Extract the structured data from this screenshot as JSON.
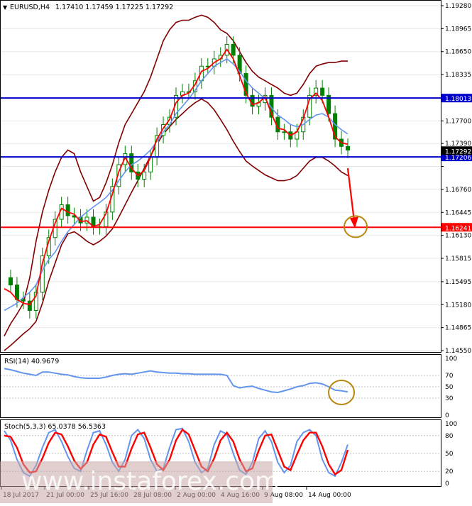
{
  "header": {
    "symbol_label": "EURUSD,H4",
    "ohlc": "1.17410 1.17459 1.17225 1.17292"
  },
  "rsi_panel": {
    "label": "RSI(14) 40.9679",
    "scale_labels": [
      "100",
      "70",
      "50",
      "30",
      "0"
    ]
  },
  "stoch_panel": {
    "label": "Stoch(5,3,3) 65.0378 56.5363",
    "scale_labels": [
      "100",
      "80",
      "50",
      "20",
      "0"
    ]
  },
  "watermark": "www.instaforex.com",
  "colors": {
    "candle": "#008000",
    "ma_fast": "#ff0000",
    "ma_slow": "#6495ed",
    "bollinger": "#800000",
    "level_line": "#0000cd",
    "target_line": "#ff0000",
    "rsi_line": "#6495ed",
    "stoch_main": "#6495ed",
    "stoch_signal": "#ff0000",
    "annotation": "#b8860b"
  },
  "chart_data": [
    {
      "type": "candlestick",
      "title": "EURUSD,H4",
      "x_ticks": [
        "18 Jul 2017",
        "21 Jul 00:00",
        "25 Jul 16:00",
        "28 Jul 08:00",
        "2 Aug 00:00",
        "4 Aug 16:00",
        "9 Aug 08:00",
        "14 Aug 00:00"
      ],
      "y_ticks": [
        1.1928,
        1.18965,
        1.1865,
        1.18335,
        1.1802,
        1.177,
        1.1739,
        1.17075,
        1.1676,
        1.16445,
        1.1613,
        1.15815,
        1.15495,
        1.1518,
        1.14865,
        1.1455
      ],
      "ylim": [
        1.1455,
        1.1928
      ],
      "price_labels": [
        "1.19280",
        "1.18965",
        "1.18650",
        "1.18335",
        "1.17700",
        "1.17390",
        "1.16760",
        "1.16445",
        "1.16130",
        "1.15815",
        "1.15495",
        "1.15180",
        "1.14865",
        "1.14550"
      ],
      "current_price": "1.17292",
      "horizontal_levels": [
        {
          "value": 1.18013,
          "label": "1.18013",
          "role": "resistance"
        },
        {
          "value": 1.17206,
          "label": "1.17206",
          "role": "support"
        },
        {
          "value": 1.16241,
          "label": "1.16241",
          "role": "target"
        }
      ],
      "close_path": [
        1.1555,
        1.1545,
        1.1525,
        1.1523,
        1.151,
        1.1535,
        1.1585,
        1.161,
        1.1635,
        1.1655,
        1.164,
        1.1638,
        1.163,
        1.1638,
        1.1625,
        1.1625,
        1.1645,
        1.168,
        1.171,
        1.1725,
        1.17,
        1.169,
        1.17,
        1.172,
        1.175,
        1.1765,
        1.1775,
        1.1805,
        1.181,
        1.181,
        1.1825,
        1.1845,
        1.1845,
        1.1855,
        1.186,
        1.1875,
        1.186,
        1.1835,
        1.1805,
        1.179,
        1.1795,
        1.1805,
        1.1775,
        1.1755,
        1.1755,
        1.1745,
        1.1755,
        1.1775,
        1.1805,
        1.1815,
        1.1805,
        1.178,
        1.1745,
        1.1735,
        1.173
      ],
      "ma_fast": [
        1.154,
        1.1535,
        1.1525,
        1.152,
        1.1518,
        1.153,
        1.1575,
        1.1605,
        1.163,
        1.165,
        1.1645,
        1.1642,
        1.1632,
        1.1633,
        1.1625,
        1.1628,
        1.1643,
        1.167,
        1.17,
        1.172,
        1.1705,
        1.1695,
        1.1702,
        1.172,
        1.1745,
        1.176,
        1.1772,
        1.1795,
        1.1805,
        1.1808,
        1.182,
        1.1838,
        1.1842,
        1.185,
        1.1855,
        1.1868,
        1.1855,
        1.1832,
        1.1808,
        1.1792,
        1.1795,
        1.1803,
        1.178,
        1.176,
        1.1758,
        1.175,
        1.1755,
        1.1773,
        1.18,
        1.1808,
        1.1798,
        1.1775,
        1.1748,
        1.174,
        1.1738
      ],
      "ma_slow": [
        1.151,
        1.1515,
        1.152,
        1.1528,
        1.1535,
        1.1545,
        1.1565,
        1.158,
        1.159,
        1.1605,
        1.1618,
        1.1628,
        1.1638,
        1.1645,
        1.1652,
        1.1658,
        1.1665,
        1.1675,
        1.1688,
        1.17,
        1.171,
        1.1715,
        1.1722,
        1.173,
        1.1742,
        1.1755,
        1.1765,
        1.178,
        1.179,
        1.18,
        1.1812,
        1.1825,
        1.1835,
        1.1845,
        1.185,
        1.1855,
        1.1848,
        1.1838,
        1.1825,
        1.1815,
        1.1808,
        1.18,
        1.1788,
        1.1778,
        1.1772,
        1.1765,
        1.1762,
        1.1765,
        1.1772,
        1.1778,
        1.178,
        1.1775,
        1.1765,
        1.1758,
        1.1752
      ],
      "bollinger_upper": [
        1.1475,
        1.1492,
        1.1505,
        1.152,
        1.1555,
        1.1605,
        1.1645,
        1.1675,
        1.17,
        1.172,
        1.173,
        1.1725,
        1.17,
        1.168,
        1.166,
        1.1665,
        1.1685,
        1.171,
        1.174,
        1.1765,
        1.178,
        1.1795,
        1.181,
        1.183,
        1.1855,
        1.188,
        1.1895,
        1.1905,
        1.1908,
        1.1908,
        1.1912,
        1.1915,
        1.1912,
        1.1905,
        1.1895,
        1.189,
        1.188,
        1.1865,
        1.185,
        1.1838,
        1.183,
        1.1825,
        1.182,
        1.1815,
        1.1808,
        1.1805,
        1.1808,
        1.182,
        1.1835,
        1.1845,
        1.1848,
        1.185,
        1.185,
        1.1852,
        1.1852
      ],
      "bollinger_lower": [
        1.1455,
        1.1462,
        1.147,
        1.1478,
        1.1485,
        1.1495,
        1.152,
        1.155,
        1.1575,
        1.16,
        1.1615,
        1.1618,
        1.1612,
        1.1605,
        1.16,
        1.1605,
        1.1612,
        1.1622,
        1.1638,
        1.1655,
        1.1672,
        1.1688,
        1.1705,
        1.1722,
        1.1738,
        1.1752,
        1.1762,
        1.1772,
        1.178,
        1.1788,
        1.1795,
        1.18,
        1.1795,
        1.1785,
        1.1772,
        1.1758,
        1.1742,
        1.1728,
        1.1715,
        1.1708,
        1.1702,
        1.1696,
        1.1692,
        1.1688,
        1.1688,
        1.169,
        1.1695,
        1.1705,
        1.1715,
        1.172,
        1.172,
        1.1715,
        1.1708,
        1.17,
        1.1695
      ],
      "forecast_arrow": {
        "from": 1.1705,
        "to": 1.1625
      }
    },
    {
      "type": "line",
      "title": "RSI(14) 40.9679",
      "ylim": [
        0,
        100
      ],
      "levels": [
        70,
        50,
        30
      ],
      "values": [
        82,
        80,
        77,
        74,
        72,
        70,
        76,
        76,
        74,
        72,
        71,
        68,
        66,
        65,
        65,
        65,
        67,
        70,
        72,
        73,
        72,
        74,
        76,
        78,
        76,
        75,
        74,
        74,
        73,
        73,
        72,
        72,
        72,
        72,
        72,
        70,
        52,
        48,
        50,
        51,
        47,
        44,
        41,
        40,
        43,
        46,
        50,
        52,
        56,
        57,
        55,
        50,
        44,
        43,
        41
      ]
    },
    {
      "type": "line",
      "title": "Stoch(5,3,3) 65.0378 56.5363",
      "ylim": [
        0,
        100
      ],
      "levels": [
        80,
        50,
        20
      ],
      "series": [
        {
          "name": "main",
          "values": [
            88,
            72,
            40,
            18,
            12,
            30,
            60,
            85,
            90,
            70,
            45,
            25,
            20,
            55,
            85,
            88,
            65,
            35,
            20,
            40,
            80,
            90,
            75,
            40,
            20,
            25,
            60,
            90,
            92,
            70,
            35,
            18,
            25,
            65,
            88,
            82,
            50,
            22,
            15,
            35,
            75,
            88,
            70,
            35,
            18,
            30,
            70,
            85,
            90,
            80,
            40,
            18,
            12,
            35,
            65
          ]
        },
        {
          "name": "signal",
          "values": [
            80,
            78,
            60,
            32,
            18,
            20,
            42,
            68,
            85,
            82,
            62,
            38,
            24,
            35,
            65,
            82,
            78,
            52,
            28,
            28,
            58,
            82,
            85,
            60,
            32,
            22,
            40,
            72,
            90,
            82,
            55,
            28,
            20,
            42,
            72,
            85,
            70,
            40,
            20,
            25,
            55,
            80,
            82,
            55,
            28,
            22,
            48,
            72,
            85,
            85,
            62,
            32,
            15,
            22,
            56
          ]
        }
      ]
    }
  ]
}
